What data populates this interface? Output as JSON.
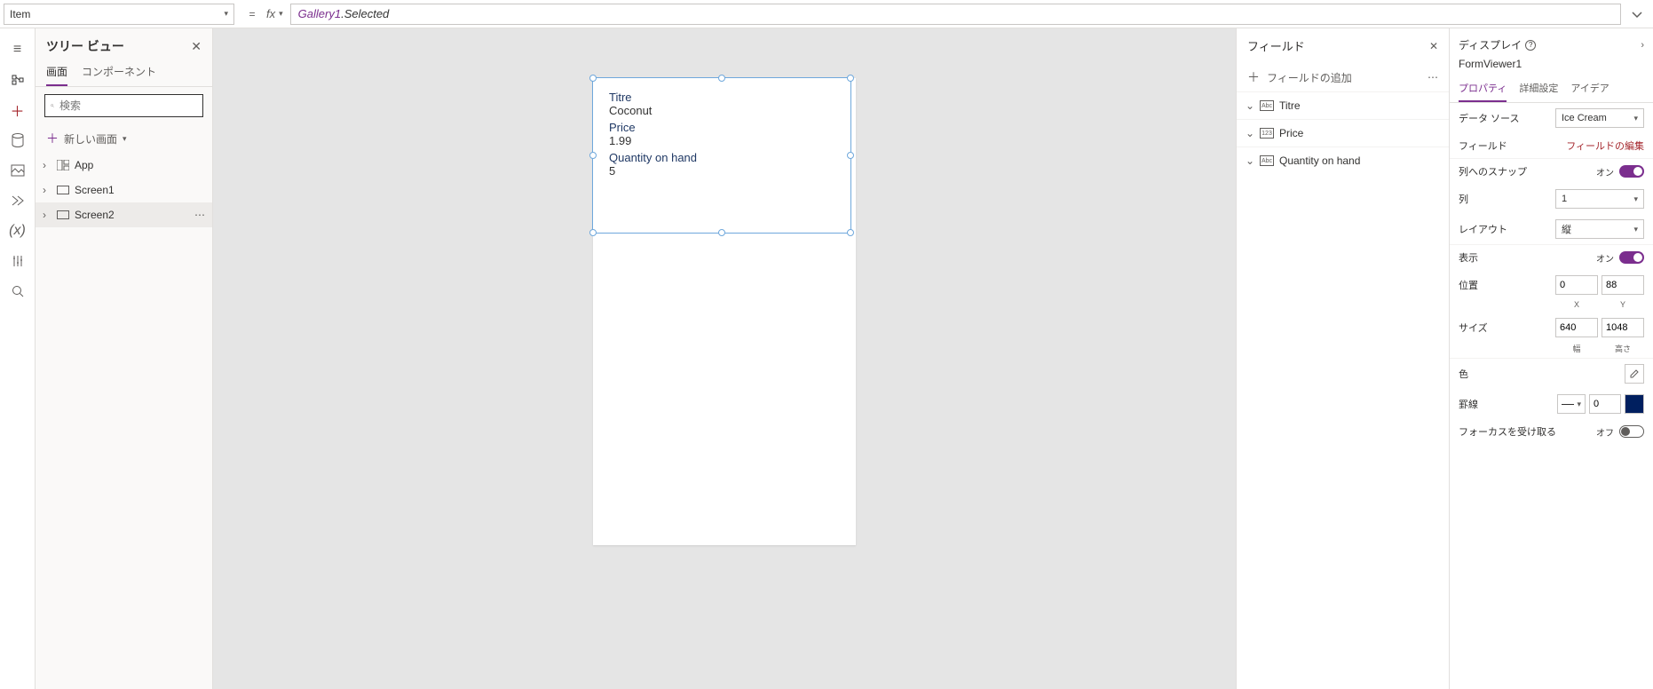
{
  "formula_bar": {
    "property": "Item",
    "object": "Gallery1",
    "member": ".Selected"
  },
  "tree": {
    "title": "ツリー ビュー",
    "tabs": {
      "screens": "画面",
      "components": "コンポーネント"
    },
    "search_placeholder": "検索",
    "new_screen": "新しい画面",
    "items": [
      {
        "label": "App",
        "type": "app"
      },
      {
        "label": "Screen1",
        "type": "screen"
      },
      {
        "label": "Screen2",
        "type": "screen",
        "selected": true
      }
    ]
  },
  "canvas": {
    "fields": [
      {
        "label": "Titre",
        "value": "Coconut"
      },
      {
        "label": "Price",
        "value": "1.99"
      },
      {
        "label": "Quantity on hand",
        "value": "5"
      }
    ]
  },
  "fields_panel": {
    "title": "フィールド",
    "add_field": "フィールドの追加",
    "items": [
      {
        "label": "Titre",
        "type": "Abc"
      },
      {
        "label": "Price",
        "type": "123"
      },
      {
        "label": "Quantity on hand",
        "type": "Abc"
      }
    ]
  },
  "props": {
    "title": "ディスプレイ",
    "control_name": "FormViewer1",
    "tabs": {
      "properties": "プロパティ",
      "advanced": "詳細設定",
      "ideas": "アイデア"
    },
    "data_source": {
      "label": "データ ソース",
      "value": "Ice Cream"
    },
    "fields": {
      "label": "フィールド",
      "link": "フィールドの編集"
    },
    "snap": {
      "label": "列へのスナップ",
      "on_label": "オン"
    },
    "columns": {
      "label": "列",
      "value": "1"
    },
    "layout": {
      "label": "レイアウト",
      "value": "縦"
    },
    "visible": {
      "label": "表示",
      "on_label": "オン"
    },
    "position": {
      "label": "位置",
      "x": "0",
      "y": "88",
      "xl": "X",
      "yl": "Y"
    },
    "size": {
      "label": "サイズ",
      "w": "640",
      "h": "1048",
      "wl": "幅",
      "hl": "高さ"
    },
    "color": {
      "label": "色"
    },
    "border": {
      "label": "罫線",
      "width": "0"
    },
    "focus": {
      "label": "フォーカスを受け取る",
      "off_label": "オフ"
    }
  }
}
